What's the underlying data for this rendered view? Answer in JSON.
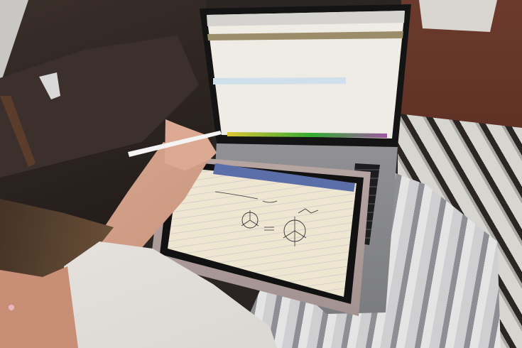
{
  "scene": {
    "description_items": [
      "laptop",
      "tablet",
      "stylus",
      "couch",
      "blanket",
      "table",
      "rug"
    ],
    "colors": {
      "couch": "#2b2320",
      "table": "#5a2e22",
      "screen": "#eeece4",
      "tablet_screen": "#efe6d2",
      "tablet_toolbar": "#5b6ea8",
      "case": "#b9a9a6",
      "laptop": "#8e8e92",
      "shirt": "#ece9e4",
      "skin": "#d9a58c",
      "hair": "#8a6a48",
      "blanket": "#b6b6b8"
    }
  }
}
